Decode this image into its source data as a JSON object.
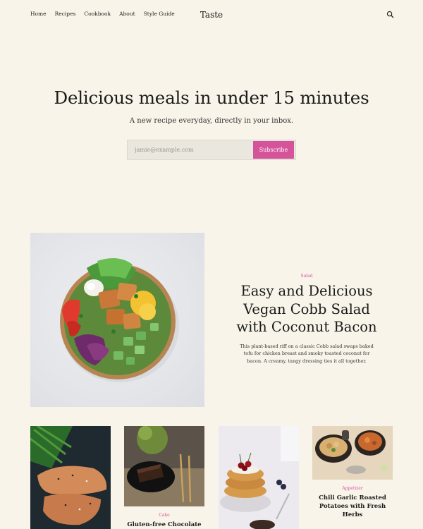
{
  "header": {
    "nav": [
      "Home",
      "Recipes",
      "Cookbook",
      "About",
      "Style Guide"
    ],
    "brand": "Taste",
    "search_icon": "search-icon"
  },
  "hero": {
    "title": "Delicious meals in under 15 minutes",
    "subtitle": "A new recipe everyday, directly in your inbox.",
    "email_placeholder": "jamie@example.com",
    "subscribe_label": "Subscribe"
  },
  "featured": {
    "category": "Salad",
    "title": "Easy and Delicious Vegan Cobb Salad with Coconut Bacon",
    "description": "This plant-based riff on a classic Cobb salad swaps baked tofu for chicken breast and smoky toasted coconut for bacon. A creamy, tangy dressing ties it all together."
  },
  "cards": [
    {
      "category": "",
      "title": ""
    },
    {
      "category": "Cake",
      "title": "Gluten-free Chocolate"
    },
    {
      "category": "",
      "title": ""
    },
    {
      "category": "Appetizer",
      "title": "Chili Garlic Roasted Potatoes with Fresh Herbs"
    }
  ],
  "colors": {
    "background": "#f8f4e9",
    "accent": "#d4539b",
    "input_bg": "#e9e7de"
  }
}
